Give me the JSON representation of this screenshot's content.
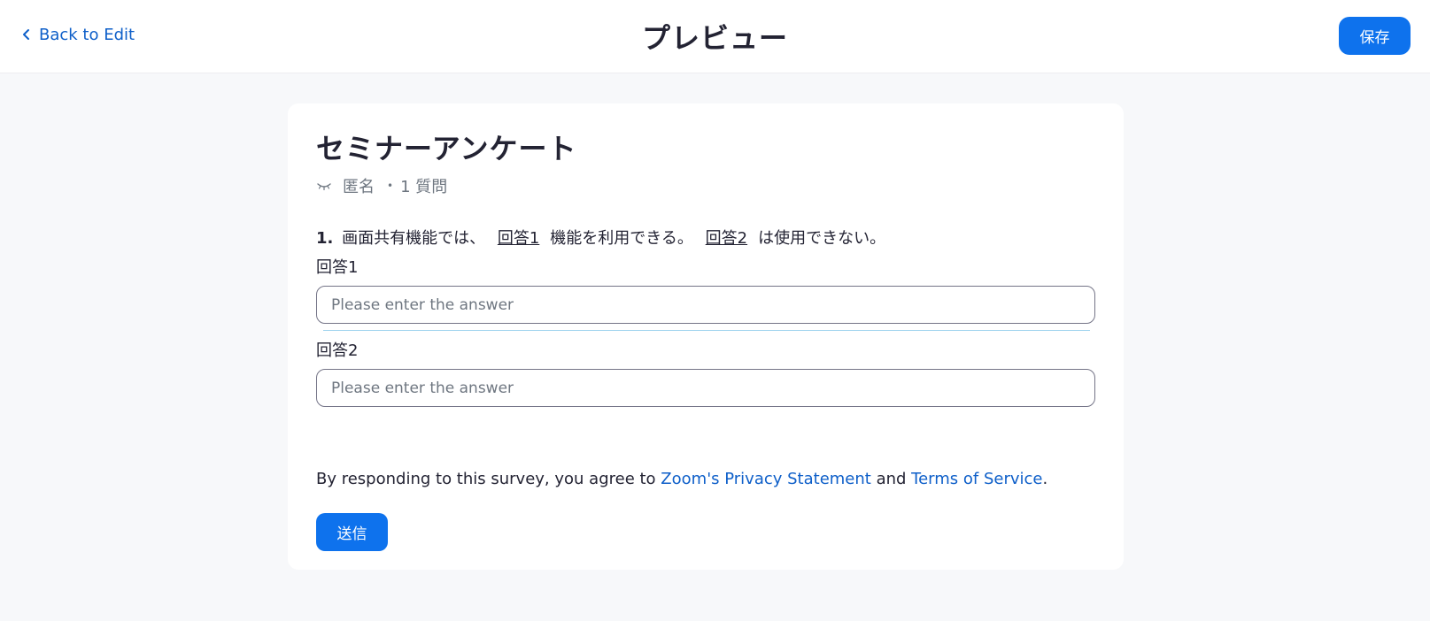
{
  "header": {
    "back_label": "Back to Edit",
    "title": "プレビュー",
    "save_label": "保存"
  },
  "survey": {
    "title": "セミナーアンケート",
    "anonymous_label": "匿名",
    "separator": "•",
    "question_count": "1 質問",
    "question": {
      "number": "1.",
      "part1": "画面共有機能では、",
      "blank1": "回答1",
      "part2": "機能を利用できる。",
      "blank2": "回答2",
      "part3": "は使用できない。"
    },
    "fields": [
      {
        "label": "回答1",
        "value": "",
        "placeholder": "Please enter the answer"
      },
      {
        "label": "回答2",
        "value": "",
        "placeholder": "Please enter the answer"
      }
    ],
    "agreement": {
      "prefix": "By responding to this survey, you agree to ",
      "privacy_link": "Zoom's Privacy Statement",
      "middle": " and ",
      "terms_link": "Terms of Service",
      "suffix": "."
    },
    "submit_label": "送信"
  },
  "icons": {
    "back": "chevron-left-icon",
    "anonymous": "eye-closed-icon"
  },
  "colors": {
    "accent": "#0e72ed",
    "link": "#0e5fc9",
    "background": "#f7f8fa",
    "text": "#232333",
    "muted": "#6e7680"
  }
}
